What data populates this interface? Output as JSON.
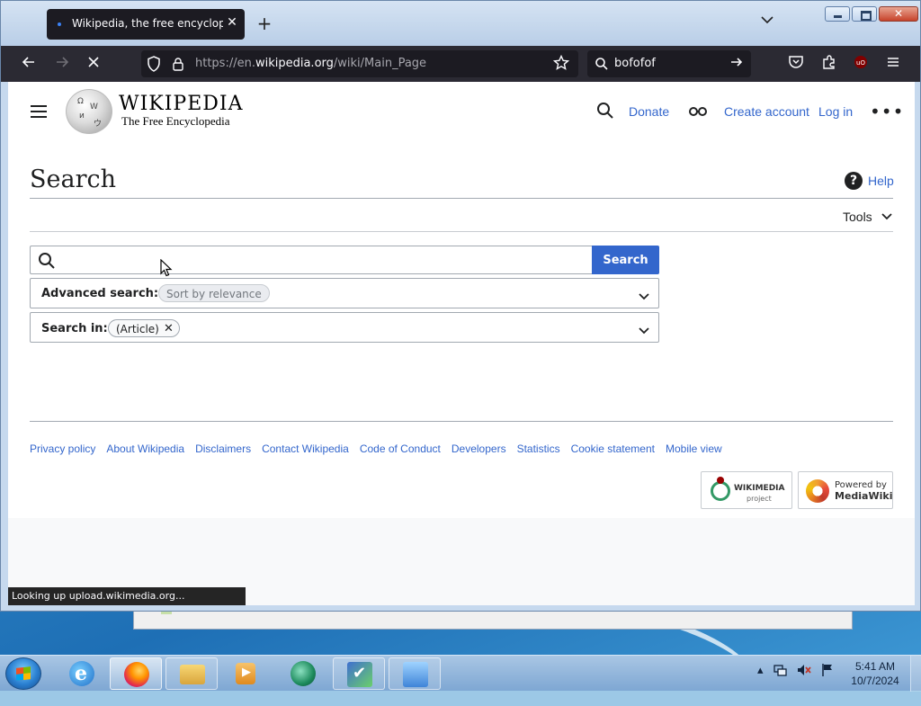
{
  "browser": {
    "tab_title": "Wikipedia, the free encyclopedia",
    "url_prefix": "https://en.",
    "url_domain": "wikipedia.org",
    "url_path": "/wiki/Main_Page",
    "search_value": "bofofof",
    "status_text": "Looking up upload.wikimedia.org..."
  },
  "wiki": {
    "wordmark": "WIKIPEDIA",
    "tagline": "The Free Encyclopedia",
    "donate": "Donate",
    "create_account": "Create account",
    "login": "Log in",
    "page_title": "Search",
    "help": "Help",
    "tools": "Tools",
    "search_button": "Search",
    "search_query": "",
    "advanced_label": "Advanced search:",
    "advanced_chip": "Sort by relevance",
    "searchin_label": "Search in:",
    "searchin_chip": "(Article)",
    "footer_links": [
      "Privacy policy",
      "About Wikipedia",
      "Disclaimers",
      "Contact Wikipedia",
      "Code of Conduct",
      "Developers",
      "Statistics",
      "Cookie statement",
      "Mobile view"
    ],
    "wikimedia_badge": "WIKIMEDIA",
    "wikimedia_sub": "project",
    "mediawiki_top": "Powered by",
    "mediawiki_bottom": "MediaWiki"
  },
  "taskbar": {
    "time": "5:41 AM",
    "date": "10/7/2024"
  },
  "colors": {
    "link": "#3366cc",
    "search_button": "#3366cc",
    "browser_chrome": "#2b2a33"
  }
}
